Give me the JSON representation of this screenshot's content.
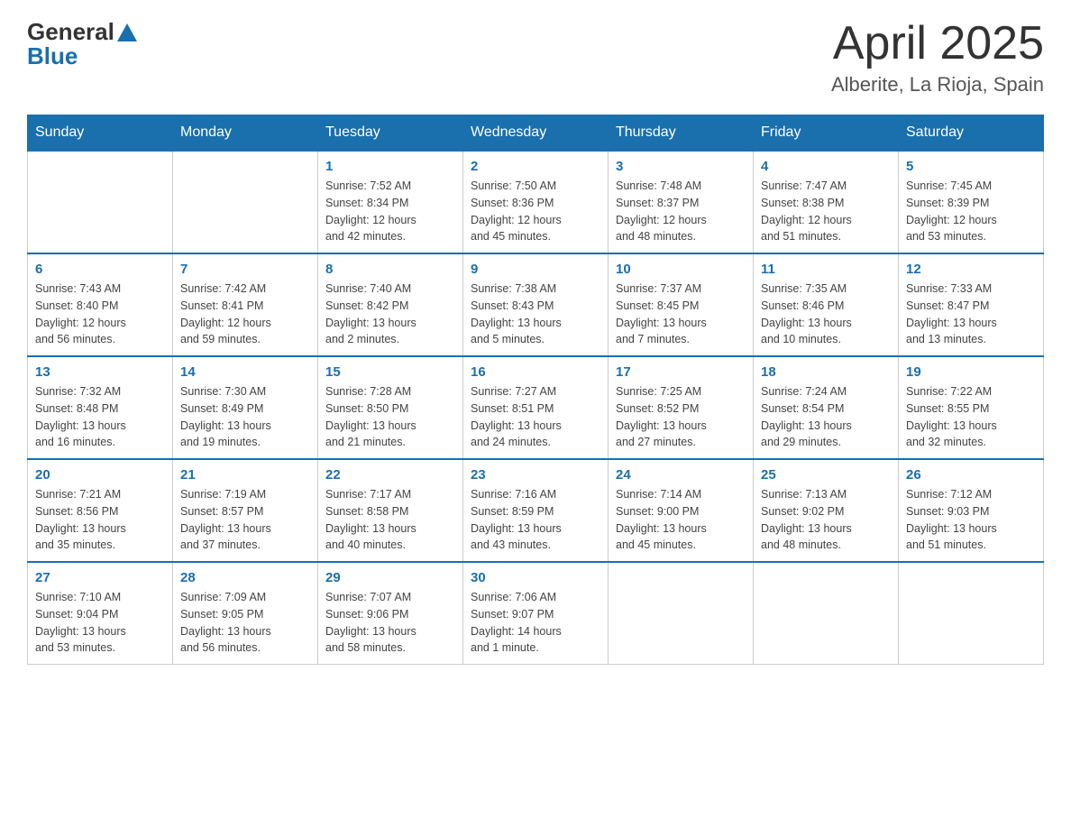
{
  "header": {
    "logo_general": "General",
    "logo_blue": "Blue",
    "title": "April 2025",
    "subtitle": "Alberite, La Rioja, Spain"
  },
  "weekdays": [
    "Sunday",
    "Monday",
    "Tuesday",
    "Wednesday",
    "Thursday",
    "Friday",
    "Saturday"
  ],
  "weeks": [
    [
      {
        "day": "",
        "info": ""
      },
      {
        "day": "",
        "info": ""
      },
      {
        "day": "1",
        "info": "Sunrise: 7:52 AM\nSunset: 8:34 PM\nDaylight: 12 hours\nand 42 minutes."
      },
      {
        "day": "2",
        "info": "Sunrise: 7:50 AM\nSunset: 8:36 PM\nDaylight: 12 hours\nand 45 minutes."
      },
      {
        "day": "3",
        "info": "Sunrise: 7:48 AM\nSunset: 8:37 PM\nDaylight: 12 hours\nand 48 minutes."
      },
      {
        "day": "4",
        "info": "Sunrise: 7:47 AM\nSunset: 8:38 PM\nDaylight: 12 hours\nand 51 minutes."
      },
      {
        "day": "5",
        "info": "Sunrise: 7:45 AM\nSunset: 8:39 PM\nDaylight: 12 hours\nand 53 minutes."
      }
    ],
    [
      {
        "day": "6",
        "info": "Sunrise: 7:43 AM\nSunset: 8:40 PM\nDaylight: 12 hours\nand 56 minutes."
      },
      {
        "day": "7",
        "info": "Sunrise: 7:42 AM\nSunset: 8:41 PM\nDaylight: 12 hours\nand 59 minutes."
      },
      {
        "day": "8",
        "info": "Sunrise: 7:40 AM\nSunset: 8:42 PM\nDaylight: 13 hours\nand 2 minutes."
      },
      {
        "day": "9",
        "info": "Sunrise: 7:38 AM\nSunset: 8:43 PM\nDaylight: 13 hours\nand 5 minutes."
      },
      {
        "day": "10",
        "info": "Sunrise: 7:37 AM\nSunset: 8:45 PM\nDaylight: 13 hours\nand 7 minutes."
      },
      {
        "day": "11",
        "info": "Sunrise: 7:35 AM\nSunset: 8:46 PM\nDaylight: 13 hours\nand 10 minutes."
      },
      {
        "day": "12",
        "info": "Sunrise: 7:33 AM\nSunset: 8:47 PM\nDaylight: 13 hours\nand 13 minutes."
      }
    ],
    [
      {
        "day": "13",
        "info": "Sunrise: 7:32 AM\nSunset: 8:48 PM\nDaylight: 13 hours\nand 16 minutes."
      },
      {
        "day": "14",
        "info": "Sunrise: 7:30 AM\nSunset: 8:49 PM\nDaylight: 13 hours\nand 19 minutes."
      },
      {
        "day": "15",
        "info": "Sunrise: 7:28 AM\nSunset: 8:50 PM\nDaylight: 13 hours\nand 21 minutes."
      },
      {
        "day": "16",
        "info": "Sunrise: 7:27 AM\nSunset: 8:51 PM\nDaylight: 13 hours\nand 24 minutes."
      },
      {
        "day": "17",
        "info": "Sunrise: 7:25 AM\nSunset: 8:52 PM\nDaylight: 13 hours\nand 27 minutes."
      },
      {
        "day": "18",
        "info": "Sunrise: 7:24 AM\nSunset: 8:54 PM\nDaylight: 13 hours\nand 29 minutes."
      },
      {
        "day": "19",
        "info": "Sunrise: 7:22 AM\nSunset: 8:55 PM\nDaylight: 13 hours\nand 32 minutes."
      }
    ],
    [
      {
        "day": "20",
        "info": "Sunrise: 7:21 AM\nSunset: 8:56 PM\nDaylight: 13 hours\nand 35 minutes."
      },
      {
        "day": "21",
        "info": "Sunrise: 7:19 AM\nSunset: 8:57 PM\nDaylight: 13 hours\nand 37 minutes."
      },
      {
        "day": "22",
        "info": "Sunrise: 7:17 AM\nSunset: 8:58 PM\nDaylight: 13 hours\nand 40 minutes."
      },
      {
        "day": "23",
        "info": "Sunrise: 7:16 AM\nSunset: 8:59 PM\nDaylight: 13 hours\nand 43 minutes."
      },
      {
        "day": "24",
        "info": "Sunrise: 7:14 AM\nSunset: 9:00 PM\nDaylight: 13 hours\nand 45 minutes."
      },
      {
        "day": "25",
        "info": "Sunrise: 7:13 AM\nSunset: 9:02 PM\nDaylight: 13 hours\nand 48 minutes."
      },
      {
        "day": "26",
        "info": "Sunrise: 7:12 AM\nSunset: 9:03 PM\nDaylight: 13 hours\nand 51 minutes."
      }
    ],
    [
      {
        "day": "27",
        "info": "Sunrise: 7:10 AM\nSunset: 9:04 PM\nDaylight: 13 hours\nand 53 minutes."
      },
      {
        "day": "28",
        "info": "Sunrise: 7:09 AM\nSunset: 9:05 PM\nDaylight: 13 hours\nand 56 minutes."
      },
      {
        "day": "29",
        "info": "Sunrise: 7:07 AM\nSunset: 9:06 PM\nDaylight: 13 hours\nand 58 minutes."
      },
      {
        "day": "30",
        "info": "Sunrise: 7:06 AM\nSunset: 9:07 PM\nDaylight: 14 hours\nand 1 minute."
      },
      {
        "day": "",
        "info": ""
      },
      {
        "day": "",
        "info": ""
      },
      {
        "day": "",
        "info": ""
      }
    ]
  ]
}
